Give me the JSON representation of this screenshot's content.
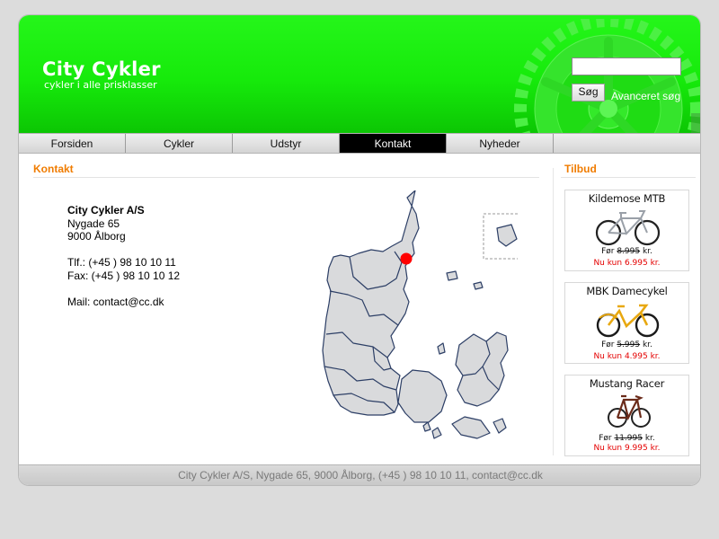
{
  "header": {
    "logo_title": "City Cykler",
    "logo_tagline": "cykler i alle prisklasser",
    "search_placeholder": "",
    "search_button": "Søg",
    "advanced_search": "Avanceret søg"
  },
  "nav": {
    "items": [
      "Forsiden",
      "Cykler",
      "Udstyr",
      "Kontakt",
      "Nyheder"
    ],
    "active": "Kontakt"
  },
  "contact": {
    "title": "Kontakt",
    "company": "City Cykler A/S",
    "street": "Nygade 65",
    "city": "9000 Ålborg",
    "phone": "Tlf.: (+45 ) 98 10 10 11",
    "fax": "Fax: (+45 ) 98 10 10 12",
    "mail": "Mail: contact@cc.dk"
  },
  "offers": {
    "title": "Tilbud",
    "items": [
      {
        "name": "Kildemose MTB",
        "before_label": "Før",
        "before_price": "8.995",
        "currency": "kr.",
        "now": "Nu kun 6.995 kr."
      },
      {
        "name": "MBK Damecykel",
        "before_label": "Før",
        "before_price": "5.995",
        "currency": "kr.",
        "now": "Nu kun 4.995 kr."
      },
      {
        "name": "Mustang Racer",
        "before_label": "Før",
        "before_price": "11.995",
        "currency": "kr.",
        "now": "Nu kun 9.995 kr."
      }
    ]
  },
  "footer": {
    "text": "City Cykler A/S, Nygade 65, 9000 Ålborg, (+45 ) 98 10 10 11, contact@cc.dk"
  },
  "colors": {
    "header_green": "#16ea0b",
    "accent_orange": "#f07c00",
    "price_red": "#e40000",
    "map_marker": "#ff0000",
    "map_fill": "#d9dadc",
    "map_stroke": "#2d3f66"
  }
}
